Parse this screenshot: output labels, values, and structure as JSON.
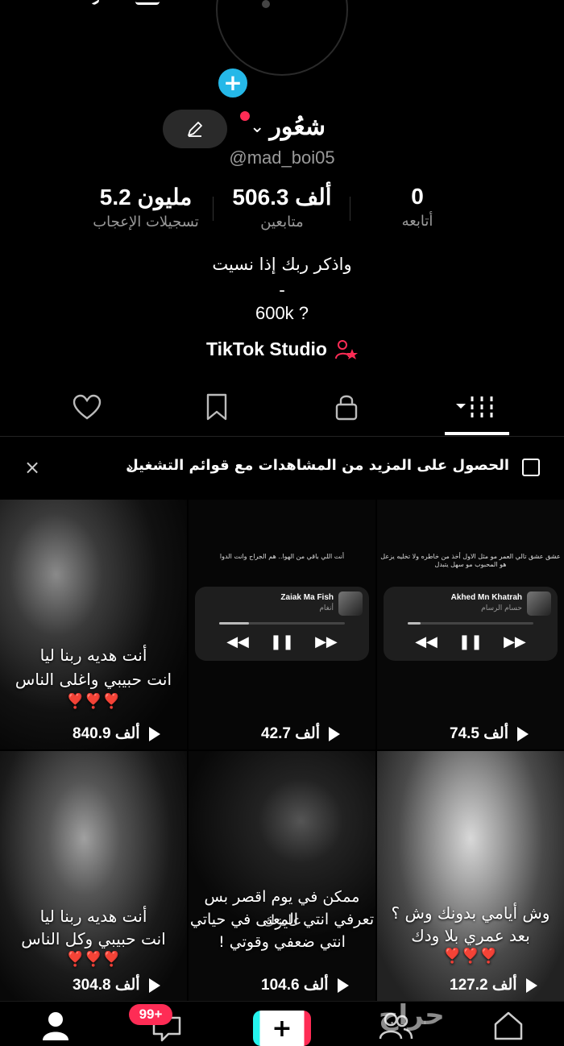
{
  "profile": {
    "username": "شعُور",
    "handle": "@mad_boi05",
    "add_avatar_symbol": "+",
    "edit_icon": "pencil-icon"
  },
  "stats": {
    "likes": {
      "value": "5.2 مليون",
      "label": "تسجيلات الإعجاب"
    },
    "followers": {
      "value": "506.3 ألف",
      "label": "متابعين"
    },
    "following": {
      "value": "0",
      "label": "أتابعه"
    }
  },
  "bio": {
    "line1": "واذكر ربك إذا نسيت",
    "line2": "-",
    "line3": "600k ?"
  },
  "studio": {
    "label": "TikTok Studio",
    "icon": "person-star-icon"
  },
  "tabs": [
    {
      "name": "liked",
      "icon": "heart-icon"
    },
    {
      "name": "saved",
      "icon": "bookmark-icon"
    },
    {
      "name": "private",
      "icon": "lock-icon"
    },
    {
      "name": "videos",
      "icon": "grid-icon",
      "active": true
    }
  ],
  "banner": {
    "text": "الحصول على المزيد من المشاهدات مع قوائم التشغيل",
    "chevron": "›",
    "close": "×"
  },
  "videos": [
    {
      "views": "74.5 ألف",
      "caption": "عشق عشق تالي العمر مو مثل الاول أخذ من خاطره ولا تخليه يزعل هو المحبوب مو سهل يتبدل",
      "player": {
        "title": "Akhed Mn Khatrah",
        "artist": "حسام الرسام"
      }
    },
    {
      "views": "42.7 ألف",
      "caption": "أنت اللي باقي من الهوا.. هم الجراح وانت الدوا",
      "player": {
        "title": "Zaiak Ma Fish",
        "artist": "أنغام"
      }
    },
    {
      "views": "840.9 ألف",
      "line1": "أنت هديه ربنا ليا",
      "line2": "انت حبيبي واغلى الناس",
      "hearts": "❣️❣️❣️"
    },
    {
      "views": "127.2 ألف",
      "line1": "وش أيامي بدونك وش ؟",
      "line2": "بعد عمري بلا ودك",
      "hearts": "❣️❣️❣️"
    },
    {
      "views": "104.6 ألف",
      "line1": "ممكن في يوم اقصر بس عايزك",
      "line2": "تعرفي انتي المعنى في حياتي",
      "line3": "انتي ضعفي وقوتي !"
    },
    {
      "views": "304.8 ألف",
      "line1": "أنت هديه ربنا ليا",
      "line2": "انت حبيبي وكل الناس",
      "hearts": "❣️❣️❣️"
    }
  ],
  "bottom_nav": {
    "badge": "99+",
    "create_symbol": "+",
    "watermark": "حراج"
  },
  "colors": {
    "accent_red": "#fe2c55",
    "accent_cyan": "#25f4ee",
    "add_blue": "#25b8e8"
  }
}
